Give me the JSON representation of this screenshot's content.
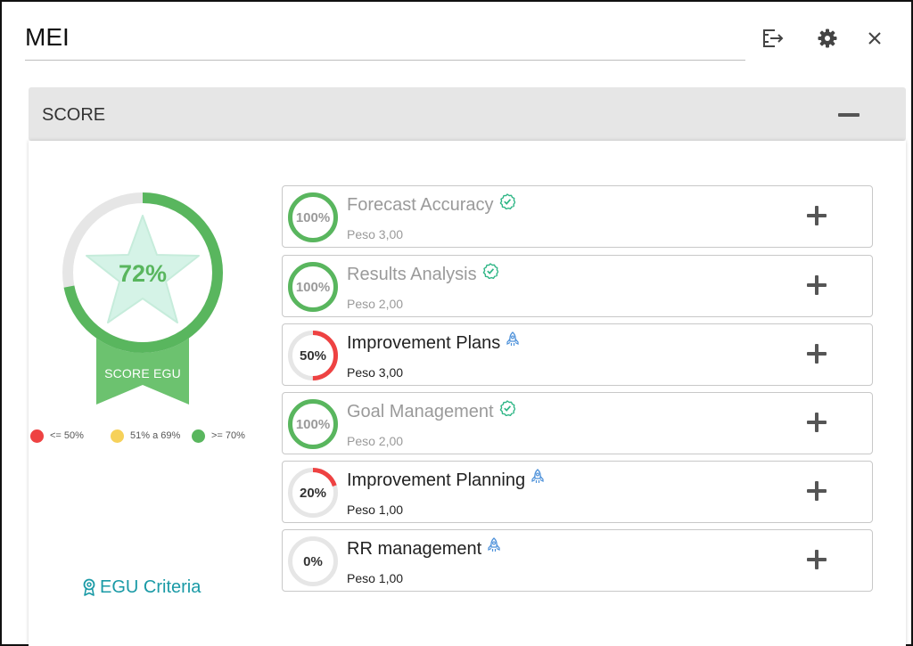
{
  "header": {
    "title": "MEI",
    "icons": {
      "export": "export-icon",
      "settings": "gear-icon",
      "close": "close-icon"
    }
  },
  "section": {
    "title": "SCORE",
    "collapse_icon": "minus-icon"
  },
  "score": {
    "value_text": "72%",
    "value": 72,
    "label": "SCORE EGU",
    "color": "#59b65e"
  },
  "legend": [
    {
      "label": "<= 50%",
      "color": "#ee4242"
    },
    {
      "label": "51% a 69%",
      "color": "#f6d15a"
    },
    {
      "label": ">= 70%",
      "color": "#59b65e"
    }
  ],
  "criteria_link": {
    "label": "EGU Criteria",
    "icon": "award-icon"
  },
  "items": [
    {
      "pct_text": "100%",
      "pct": 100,
      "name": "Forecast Accuracy",
      "weight": "Peso 3,00",
      "status": "check-circle-icon",
      "done": true,
      "color": "#59b65e"
    },
    {
      "pct_text": "100%",
      "pct": 100,
      "name": "Results Analysis",
      "weight": "Peso 2,00",
      "status": "check-circle-icon",
      "done": true,
      "color": "#59b65e"
    },
    {
      "pct_text": "50%",
      "pct": 50,
      "name": "Improvement Plans",
      "weight": "Peso 3,00",
      "status": "rocket-icon",
      "done": false,
      "color": "#ee4242"
    },
    {
      "pct_text": "100%",
      "pct": 100,
      "name": "Goal Management",
      "weight": "Peso 2,00",
      "status": "check-circle-icon",
      "done": true,
      "color": "#59b65e"
    },
    {
      "pct_text": "20%",
      "pct": 20,
      "name": "Improvement Planning",
      "weight": "Peso 1,00",
      "status": "rocket-icon",
      "done": false,
      "color": "#ee4242"
    },
    {
      "pct_text": "0%",
      "pct": 0,
      "name": "RR management",
      "weight": "Peso 1,00",
      "status": "rocket-icon",
      "done": false,
      "color": "#ee4242"
    }
  ]
}
